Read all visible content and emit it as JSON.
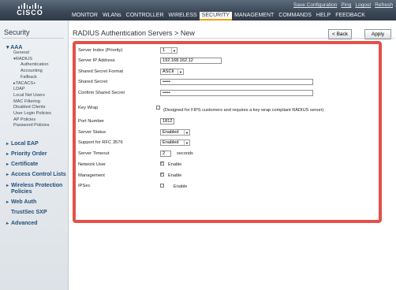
{
  "brand": {
    "logo_text": "CISCO"
  },
  "top_links": {
    "save": "Save Configuration",
    "ping": "Ping",
    "logout": "Logout",
    "refresh": "Refresh"
  },
  "main_nav": [
    "MONITOR",
    "WLANs",
    "CONTROLLER",
    "WIRELESS",
    "SECURITY",
    "MANAGEMENT",
    "COMMANDS",
    "HELP",
    "FEEDBACK"
  ],
  "main_nav_active": "SECURITY",
  "sidebar": {
    "title": "Security",
    "aaa": {
      "label": "AAA",
      "items": [
        "General",
        "RADIUS",
        "Authentication",
        "Accounting",
        "Fallback",
        "TACACS+",
        "LDAP",
        "Local Net Users",
        "MAC Filtering",
        "Disabled Clients",
        "User Login Policies",
        "AP Policies",
        "Password Policies"
      ]
    },
    "sections": [
      "Local EAP",
      "Priority Order",
      "Certificate",
      "Access Control Lists",
      "Wireless Protection",
      "Policies",
      "Web Auth",
      "TrustSec SXP",
      "Advanced"
    ]
  },
  "content": {
    "title": "RADIUS Authentication Servers > New",
    "back_button": "< Back",
    "apply_button": "Apply"
  },
  "form": {
    "server_index": {
      "label": "Server Index (Priority)",
      "value": "1"
    },
    "server_ip": {
      "label": "Server IP Address",
      "value": "192.168.162.12"
    },
    "secret_format": {
      "label": "Shared Secret Format",
      "value": "ASCII"
    },
    "shared_secret": {
      "label": "Shared Secret",
      "value": "•••••"
    },
    "confirm_secret": {
      "label": "Confirm Shared Secret",
      "value": "•••••"
    },
    "key_wrap": {
      "label": "Key Wrap",
      "note": "(Designed for FIPS customers and requires a key wrap compliant RADIUS server)",
      "checked": false
    },
    "port_number": {
      "label": "Port Number",
      "value": "1812"
    },
    "server_status": {
      "label": "Server Status",
      "value": "Enabled"
    },
    "rfc3576": {
      "label": "Support for RFC 3576",
      "value": "Enabled"
    },
    "timeout": {
      "label": "Server Timeout",
      "value": "2",
      "unit": "seconds"
    },
    "network_user": {
      "label": "Network User",
      "text": "Enable",
      "checked": true
    },
    "management": {
      "label": "Management",
      "text": "Enable",
      "checked": true
    },
    "ipsec": {
      "label": "IPSec",
      "text": "Enable",
      "checked": false
    }
  },
  "colors": {
    "highlight_border": "#e2514a",
    "nav_active_underline": "#f2a000",
    "section_text": "#1f4f7a"
  }
}
